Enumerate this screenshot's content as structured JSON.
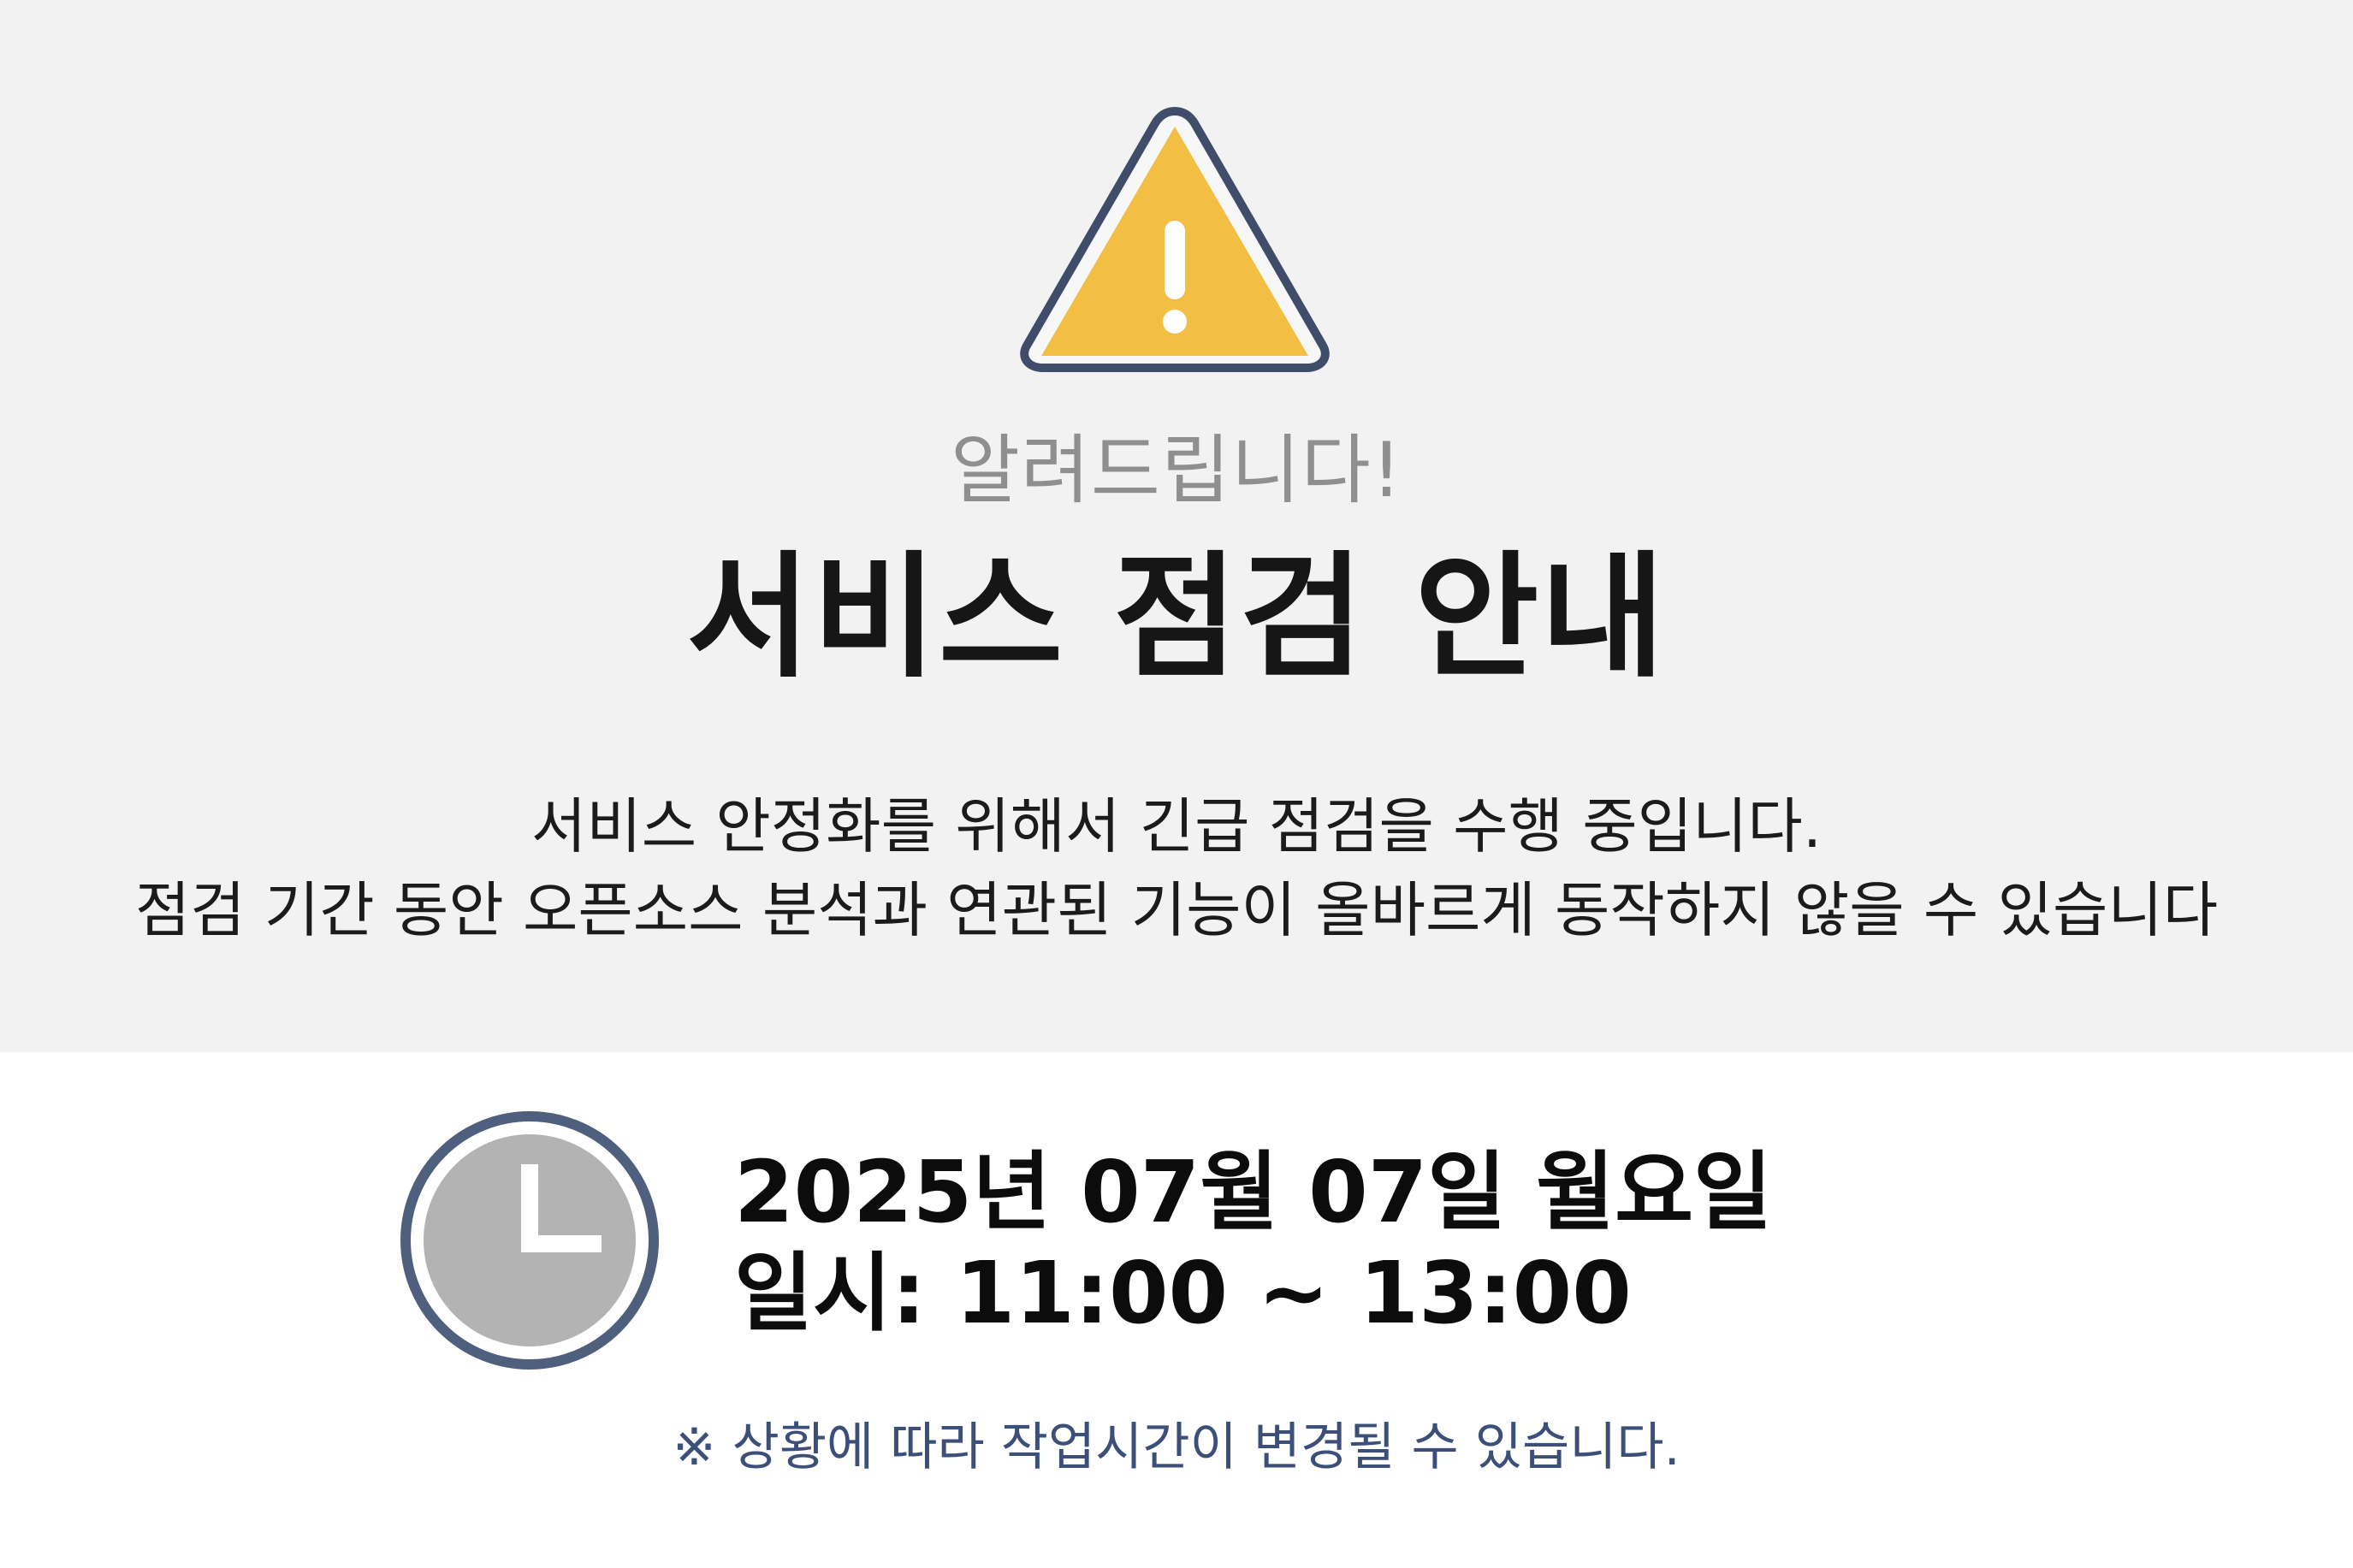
{
  "notice": {
    "eyebrow": "알려드립니다!",
    "title": "서비스 점검 안내",
    "description_line_1": "서비스 안정화를 위해서 긴급 점검을 수행 중입니다.",
    "description_line_2": "점검 기간 동안 오픈소스 분석과 연관된 기능이 올바르게 동작하지 않을 수 있습니다",
    "warning_icon": "warning-triangle-icon",
    "colors": {
      "panel_background": "#f2f2f2",
      "warning_fill": "#f2be43",
      "warning_outline": "#3f4d6b",
      "clock_outline": "#4f5f7e",
      "clock_face": "#b3b3b3",
      "note_text": "#3c4f79"
    }
  },
  "schedule": {
    "date": "2025년 07월 07일 월요일",
    "time": "일시: 11:00 ~ 13:00",
    "clock_icon": "clock-icon"
  },
  "footer_note": "※ 상황에 따라 작업시간이 변경될 수 있습니다."
}
